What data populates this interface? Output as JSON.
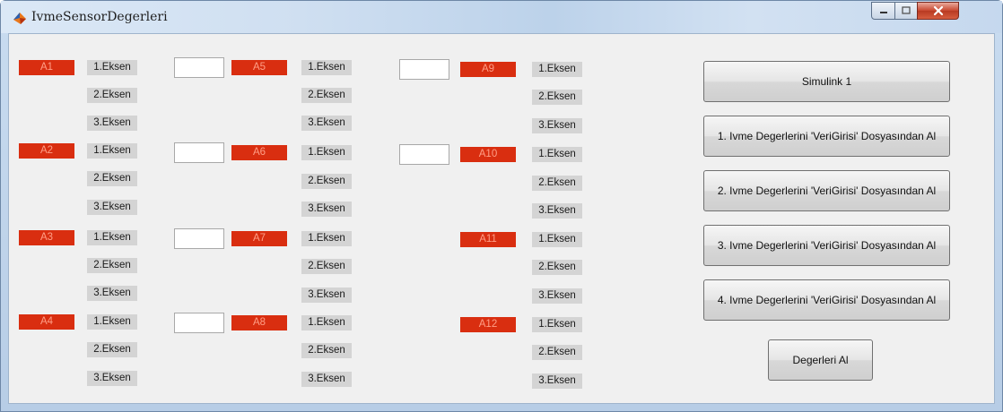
{
  "window": {
    "title": "IvmeSensorDegerleri"
  },
  "axes": [
    "1.Eksen",
    "2.Eksen",
    "3.Eksen"
  ],
  "sensors": [
    "A1",
    "A2",
    "A3",
    "A4",
    "A5",
    "A6",
    "A7",
    "A8",
    "A9",
    "A10",
    "A11",
    "A12"
  ],
  "buttons": {
    "simulink": "Simulink 1",
    "load1": "1. Ivme Degerlerini 'VeriGirisi' Dosyasından Al",
    "load2": "2. Ivme Degerlerini 'VeriGirisi' Dosyasından Al",
    "load3": "3. Ivme Degerlerini 'VeriGirisi' Dosyasından Al",
    "load4": "4. Ivme Degerlerini 'VeriGirisi' Dosyasından Al",
    "get_values": "Degerleri Al"
  },
  "colors": {
    "sensor_label_bg": "#d92e10",
    "axis_label_bg": "#d4d4d4",
    "panel_bg": "#f0f0f0",
    "close_button": "#c8462f"
  }
}
